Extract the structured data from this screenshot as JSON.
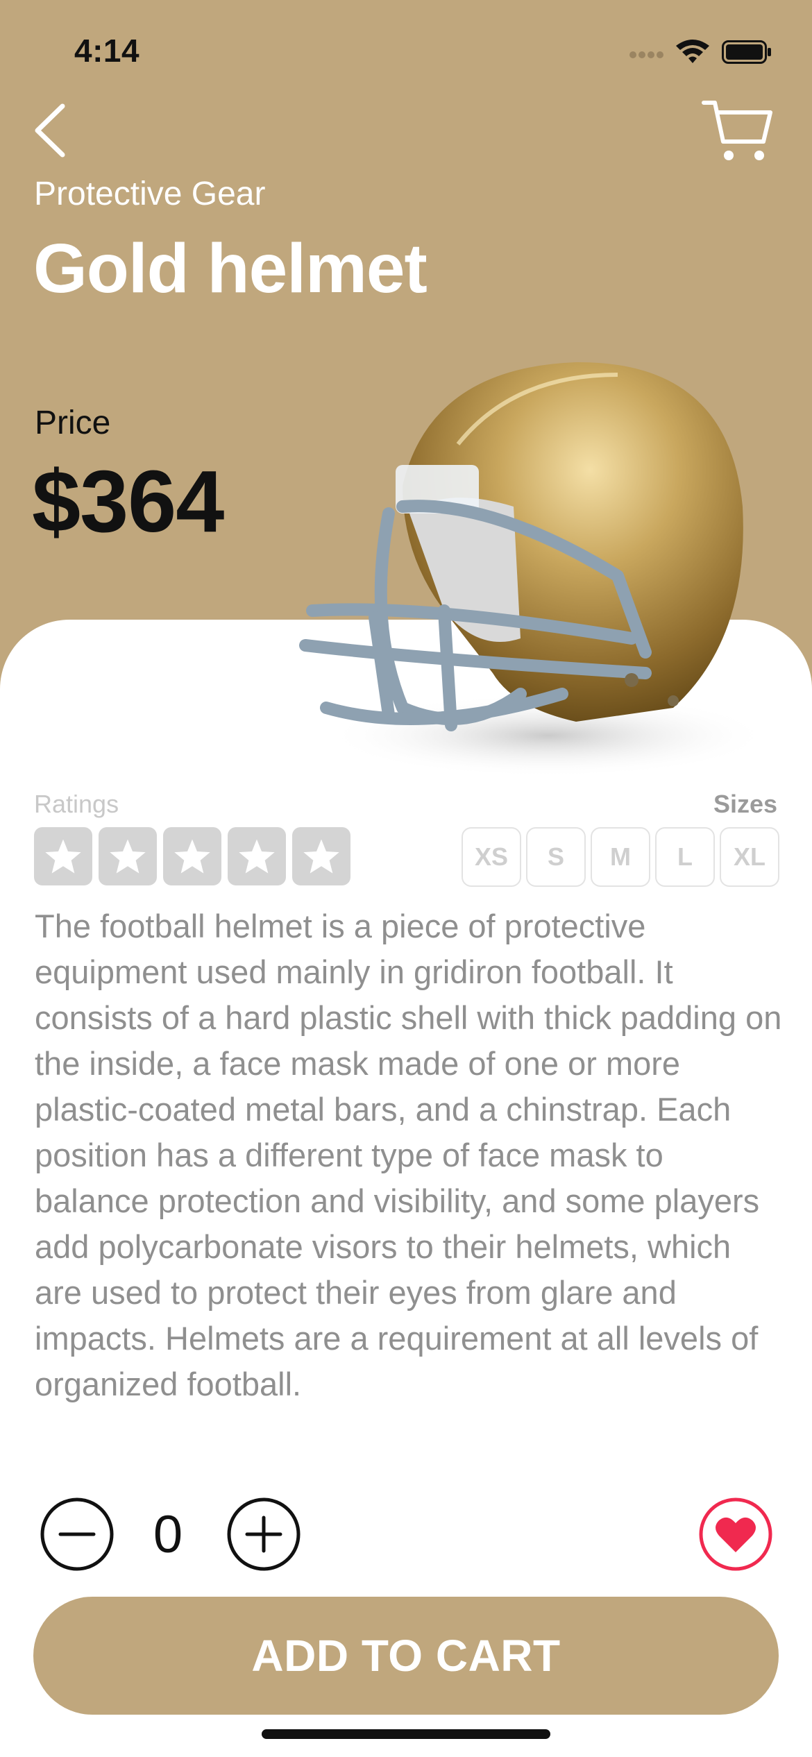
{
  "status_bar": {
    "time": "4:14"
  },
  "header": {
    "category": "Protective Gear",
    "title": "Gold helmet"
  },
  "price": {
    "label": "Price",
    "value": "$364"
  },
  "ratings": {
    "label": "Ratings",
    "stars_total": 5,
    "stars_filled": 0
  },
  "sizes": {
    "label": "Sizes",
    "options": [
      "XS",
      "S",
      "M",
      "L",
      "XL"
    ]
  },
  "description": "The football helmet is a piece of protective equipment used mainly in gridiron football. It consists of a hard plastic shell with thick padding on the inside, a face mask made of one or more plastic-coated metal bars, and a chinstrap. Each position has a different type of face mask to balance protection and visibility, and some players add polycarbonate visors to their helmets, which are used to protect their eyes from glare and impacts. Helmets are a requirement at all levels of organized football.",
  "quantity": {
    "value": "0"
  },
  "cta": {
    "label": "ADD TO CART"
  },
  "colors": {
    "accent": "#c0a77d",
    "favorite": "#f0294f",
    "star_inactive": "#d4d4d4"
  },
  "icons": {
    "back": "chevron-left-icon",
    "cart": "cart-icon",
    "minus": "minus-circle-icon",
    "plus": "plus-circle-icon",
    "favorite": "heart-icon"
  }
}
